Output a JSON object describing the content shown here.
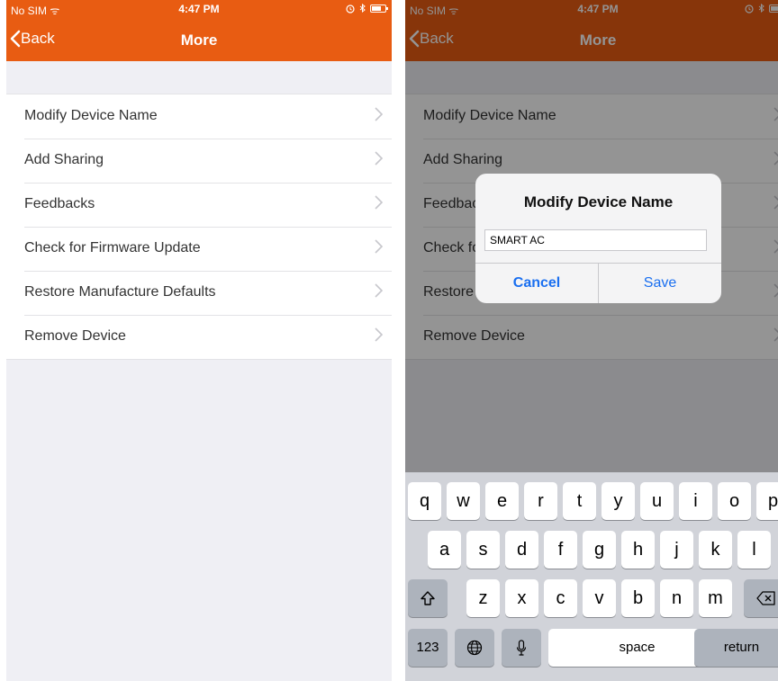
{
  "status_bar": {
    "carrier": "No SIM ᯤ",
    "time": "4:47 PM",
    "right_icons": [
      "alarm-icon",
      "bluetooth-icon",
      "battery-icon"
    ]
  },
  "nav": {
    "back_label": "Back",
    "title": "More"
  },
  "menu": {
    "items": [
      {
        "label": "Modify Device Name"
      },
      {
        "label": "Add Sharing"
      },
      {
        "label": "Feedbacks"
      },
      {
        "label": "Check for Firmware Update"
      },
      {
        "label": "Restore Manufacture Defaults"
      },
      {
        "label": "Remove Device"
      }
    ]
  },
  "dialog": {
    "title": "Modify Device Name",
    "input_value": "SMART AC",
    "cancel_label": "Cancel",
    "save_label": "Save"
  },
  "keyboard": {
    "row1": [
      "q",
      "w",
      "e",
      "r",
      "t",
      "y",
      "u",
      "i",
      "o",
      "p"
    ],
    "row2": [
      "a",
      "s",
      "d",
      "f",
      "g",
      "h",
      "j",
      "k",
      "l"
    ],
    "row3": [
      "z",
      "x",
      "c",
      "v",
      "b",
      "n",
      "m"
    ],
    "numbers_label": "123",
    "space_label": "space",
    "return_label": "return"
  },
  "colors": {
    "accent": "#e85c12",
    "link": "#1a6ff0",
    "background": "#efeff4"
  }
}
